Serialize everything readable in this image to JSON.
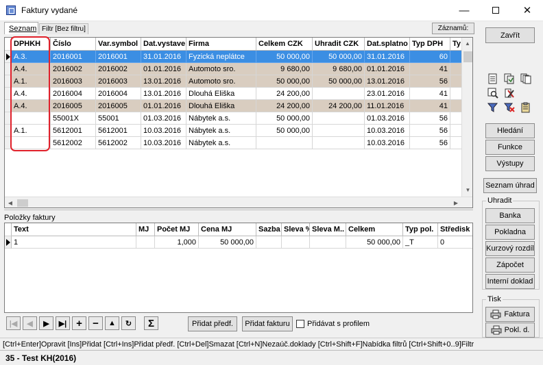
{
  "window": {
    "title": "Faktury vydané"
  },
  "tabs": {
    "seznam": "Seznam",
    "filtr": "Filtr [Bez filtru]"
  },
  "zaznamy_label": "Záznamů:",
  "invoices": {
    "columns": [
      "DPHKH",
      "Číslo",
      "Var.symbol",
      "Dat.vystave",
      "Firma",
      "Celkem CZK",
      "Uhradit CZK",
      "Dat.splatno",
      "Typ DPH",
      "Ty"
    ],
    "rows": [
      {
        "dphkh": "A.3.",
        "cislo": "2016001",
        "varsym": "2016001",
        "datvyst": "31.01.2016",
        "firma": "Fyzická neplátce",
        "celkem": "50 000,00",
        "uhradit": "50 000,00",
        "datspl": "31.01.2016",
        "typdph": "60",
        "style": "sel"
      },
      {
        "dphkh": "A.4.",
        "cislo": "2016002",
        "varsym": "2016002",
        "datvyst": "01.01.2016",
        "firma": "Automoto sro.",
        "celkem": "9 680,00",
        "uhradit": "9 680,00",
        "datspl": "01.01.2016",
        "typdph": "41",
        "style": "tan"
      },
      {
        "dphkh": "A.1.",
        "cislo": "2016003",
        "varsym": "2016003",
        "datvyst": "13.01.2016",
        "firma": "Automoto sro.",
        "celkem": "50 000,00",
        "uhradit": "50 000,00",
        "datspl": "13.01.2016",
        "typdph": "56",
        "style": "tan"
      },
      {
        "dphkh": "A.4.",
        "cislo": "2016004",
        "varsym": "2016004",
        "datvyst": "13.01.2016",
        "firma": "Dlouhá Eliška",
        "celkem": "24 200,00",
        "uhradit": "",
        "datspl": "23.01.2016",
        "typdph": "41",
        "style": "white"
      },
      {
        "dphkh": "A.4.",
        "cislo": "2016005",
        "varsym": "2016005",
        "datvyst": "01.01.2016",
        "firma": "Dlouhá Eliška",
        "celkem": "24 200,00",
        "uhradit": "24 200,00",
        "datspl": "11.01.2016",
        "typdph": "41",
        "style": "tan"
      },
      {
        "dphkh": "",
        "cislo": "55001X",
        "varsym": "55001",
        "datvyst": "01.03.2016",
        "firma": "Nábytek a.s.",
        "celkem": "50 000,00",
        "uhradit": "",
        "datspl": "01.03.2016",
        "typdph": "56",
        "style": "white"
      },
      {
        "dphkh": "A.1.",
        "cislo": "5612001",
        "varsym": "5612001",
        "datvyst": "10.03.2016",
        "firma": "Nábytek a.s.",
        "celkem": "50 000,00",
        "uhradit": "",
        "datspl": "10.03.2016",
        "typdph": "56",
        "style": "white"
      },
      {
        "dphkh": "",
        "cislo": "5612002",
        "varsym": "5612002",
        "datvyst": "10.03.2016",
        "firma": "Nábytek a.s.",
        "celkem": "",
        "uhradit": "",
        "datspl": "10.03.2016",
        "typdph": "56",
        "style": "white"
      }
    ]
  },
  "items": {
    "section_label": "Položky faktury",
    "columns": [
      "Text",
      "MJ",
      "Počet MJ",
      "Cena MJ",
      "Sazba",
      "Sleva %",
      "Sleva M..",
      "Celkem",
      "Typ pol.",
      "Středisk"
    ],
    "rows": [
      {
        "text": "1",
        "mj": "",
        "pocet": "1,000",
        "cena": "50 000,00",
        "sazba": "",
        "sleva": "",
        "slevam": "",
        "celkem": "50 000,00",
        "typ": "_T",
        "stred": "0"
      }
    ]
  },
  "right_panel": {
    "zavrit": "Zavřít",
    "hledani": "Hledání",
    "funkce": "Funkce",
    "vystupy": "Výstupy",
    "seznam_uhrad": "Seznam úhrad",
    "uhradit_legend": "Uhradit",
    "banka": "Banka",
    "pokladna": "Pokladna",
    "kurzovy": "Kurzový rozdíl",
    "zapocet": "Zápočet",
    "interni": "Interní doklad",
    "tisk_legend": "Tisk",
    "tisk_faktura": "Faktura",
    "tisk_pokl": "Pokl. d."
  },
  "bottom_bar": {
    "pridat_predf": "Přidat předf.",
    "pridat_fakturu": "Přidat fakturu",
    "pridavat_profil": "Přidávat s profilem",
    "sum_symbol": "Σ"
  },
  "hotkeys": "[Ctrl+Enter]Opravit [Ins]Přidat [Ctrl+Ins]Přidat předf.  [Ctrl+Del]Smazat [Ctrl+N]Nezaúč.doklady  [Ctrl+Shift+F]Nabídka filtrů [Ctrl+Shift+0..9]Filtr",
  "status": "35 - Test KH(2016)",
  "colors": {
    "selected": "#3b8ee3",
    "tan": "#d9cdc0",
    "annotation": "#e0202a"
  }
}
